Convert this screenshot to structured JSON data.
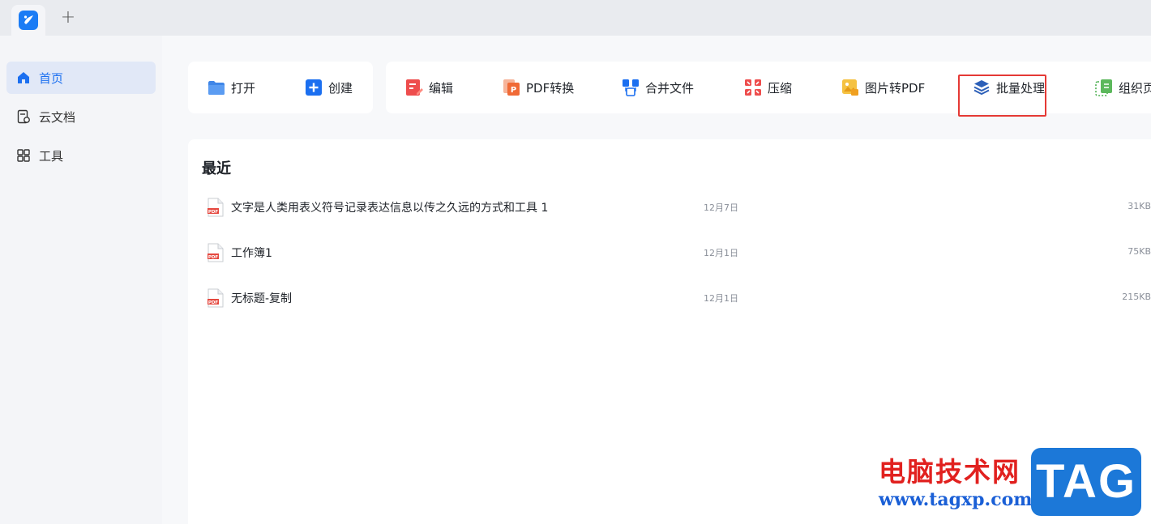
{
  "topbar": {
    "new_tab_symbol": "+"
  },
  "sidebar": {
    "items": [
      {
        "label": "首页",
        "icon": "home-icon",
        "active": true
      },
      {
        "label": "云文档",
        "icon": "cloud-doc-icon",
        "active": false
      },
      {
        "label": "工具",
        "icon": "tools-grid-icon",
        "active": false
      }
    ]
  },
  "quick_actions": [
    {
      "label": "打开",
      "icon": "folder-open-icon"
    },
    {
      "label": "创建",
      "icon": "plus-square-icon"
    }
  ],
  "tools": [
    {
      "label": "编辑",
      "icon": "edit-icon"
    },
    {
      "label": "PDF转换",
      "icon": "pdf-convert-icon"
    },
    {
      "label": "合并文件",
      "icon": "merge-icon"
    },
    {
      "label": "压缩",
      "icon": "compress-icon"
    },
    {
      "label": "图片转PDF",
      "icon": "image-to-pdf-icon"
    },
    {
      "label": "批量处理",
      "icon": "layers-icon",
      "highlighted": true
    },
    {
      "label": "组织页",
      "icon": "organize-pages-icon"
    }
  ],
  "recent": {
    "title": "最近",
    "files": [
      {
        "name": "文字是人类用表义符号记录表达信息以传之久远的方式和工具 1",
        "date": "12月7日",
        "size": "31KB"
      },
      {
        "name": "工作簿1",
        "date": "12月1日",
        "size": "75KB"
      },
      {
        "name": "无标题-复制",
        "date": "12月1日",
        "size": "215KB"
      }
    ],
    "file_icon_label": "PDF"
  },
  "watermark": {
    "site_name": "电脑技术网",
    "url": "www.tagxp.com",
    "badge": "TAG"
  },
  "colors": {
    "accent": "#1b6ff0",
    "highlight_border": "#e53935",
    "pdf_red": "#e5483f"
  }
}
